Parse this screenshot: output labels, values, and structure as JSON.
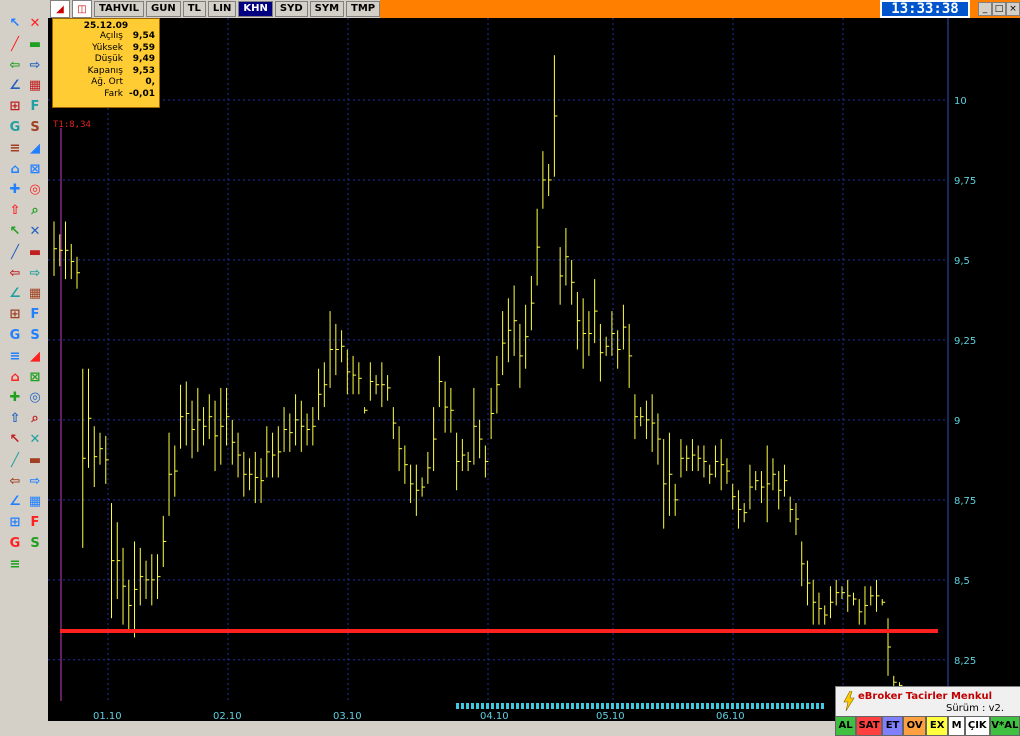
{
  "toolbar": {
    "tabs": [
      "TAHVIL",
      "GUN",
      "TL",
      "LIN",
      "KHN",
      "SYD",
      "SYM",
      "TMP"
    ],
    "active_tab": "KHN",
    "clock": "13:33:38",
    "window_buttons": [
      "_",
      "□",
      "×"
    ]
  },
  "infobox": {
    "date": "25.12.09",
    "rows": [
      {
        "label": "Açılış",
        "value": "9,54"
      },
      {
        "label": "Yüksek",
        "value": "9,59"
      },
      {
        "label": "Düşük",
        "value": "9,49"
      },
      {
        "label": "Kapanış",
        "value": "9,53"
      },
      {
        "label": "Ağ. Ort",
        "value": "0,"
      },
      {
        "label": "Fark",
        "value": "-0,01"
      }
    ]
  },
  "trendline_label": "T1:8,34",
  "colors": {
    "bars": "#ffff40",
    "trendline": "#ff2020",
    "grid": "#2030a0",
    "axis_text": "#5fd0e0",
    "titlebar": "#ff8000"
  },
  "chart_data": {
    "type": "ohlc",
    "y_ticks": [
      "10",
      "9,75",
      "9,5",
      "9,25",
      "9",
      "8,75",
      "8,5",
      "8,25"
    ],
    "x_ticks": [
      "01.10",
      "02.10",
      "03.10",
      "04.10",
      "05.10",
      "06.10"
    ],
    "ylim": [
      8.14,
      10.25
    ],
    "trendline_value": 8.34,
    "series": [
      {
        "h": 9.62,
        "l": 9.45
      },
      {
        "h": 9.58,
        "l": 9.48
      },
      {
        "h": 9.62,
        "l": 9.44
      },
      {
        "h": 9.55,
        "l": 9.44
      },
      {
        "h": 9.51,
        "l": 9.41
      },
      {
        "h": 9.16,
        "l": 8.6
      },
      {
        "h": 9.16,
        "l": 8.85
      },
      {
        "h": 8.98,
        "l": 8.79
      },
      {
        "h": 8.96,
        "l": 8.86
      },
      {
        "h": 8.95,
        "l": 8.8
      },
      {
        "h": 8.74,
        "l": 8.38
      },
      {
        "h": 8.68,
        "l": 8.44
      },
      {
        "h": 8.6,
        "l": 8.36
      },
      {
        "h": 8.5,
        "l": 8.34
      },
      {
        "h": 8.62,
        "l": 8.32
      },
      {
        "h": 8.6,
        "l": 8.42
      },
      {
        "h": 8.56,
        "l": 8.44
      },
      {
        "h": 8.58,
        "l": 8.42
      },
      {
        "h": 8.58,
        "l": 8.44
      },
      {
        "h": 8.7,
        "l": 8.54
      },
      {
        "h": 8.96,
        "l": 8.7
      },
      {
        "h": 8.92,
        "l": 8.76
      },
      {
        "h": 9.11,
        "l": 8.91
      },
      {
        "h": 9.12,
        "l": 8.92
      },
      {
        "h": 9.06,
        "l": 8.88
      },
      {
        "h": 9.1,
        "l": 8.9
      },
      {
        "h": 9.04,
        "l": 8.92
      },
      {
        "h": 9.08,
        "l": 8.94
      },
      {
        "h": 9.06,
        "l": 8.84
      },
      {
        "h": 9.1,
        "l": 8.86
      },
      {
        "h": 9.1,
        "l": 8.92
      },
      {
        "h": 9.0,
        "l": 8.86
      },
      {
        "h": 8.96,
        "l": 8.82
      },
      {
        "h": 8.9,
        "l": 8.76
      },
      {
        "h": 8.88,
        "l": 8.78
      },
      {
        "h": 8.9,
        "l": 8.74
      },
      {
        "h": 8.88,
        "l": 8.74
      },
      {
        "h": 8.98,
        "l": 8.82
      },
      {
        "h": 8.96,
        "l": 8.82
      },
      {
        "h": 8.98,
        "l": 8.82
      },
      {
        "h": 9.04,
        "l": 8.9
      },
      {
        "h": 9.02,
        "l": 8.9
      },
      {
        "h": 9.08,
        "l": 8.92
      },
      {
        "h": 9.06,
        "l": 8.9
      },
      {
        "h": 9.02,
        "l": 8.92
      },
      {
        "h": 9.04,
        "l": 8.92
      },
      {
        "h": 9.16,
        "l": 9.0
      },
      {
        "h": 9.18,
        "l": 9.04
      },
      {
        "h": 9.34,
        "l": 9.1
      },
      {
        "h": 9.3,
        "l": 9.14
      },
      {
        "h": 9.28,
        "l": 9.18
      },
      {
        "h": 9.22,
        "l": 9.08
      },
      {
        "h": 9.2,
        "l": 9.08
      },
      {
        "h": 9.18,
        "l": 9.08
      },
      {
        "h": 9.04,
        "l": 9.02
      },
      {
        "h": 9.18,
        "l": 9.06
      },
      {
        "h": 9.14,
        "l": 9.08
      },
      {
        "h": 9.18,
        "l": 9.04
      },
      {
        "h": 9.14,
        "l": 9.06
      },
      {
        "h": 9.04,
        "l": 8.94
      },
      {
        "h": 8.98,
        "l": 8.84
      },
      {
        "h": 8.92,
        "l": 8.8
      },
      {
        "h": 8.86,
        "l": 8.74
      },
      {
        "h": 8.86,
        "l": 8.7
      },
      {
        "h": 8.82,
        "l": 8.76
      },
      {
        "h": 8.9,
        "l": 8.8
      },
      {
        "h": 9.04,
        "l": 8.84
      },
      {
        "h": 9.2,
        "l": 9.04
      },
      {
        "h": 9.12,
        "l": 8.96
      },
      {
        "h": 9.1,
        "l": 8.96
      },
      {
        "h": 8.96,
        "l": 8.78
      },
      {
        "h": 8.94,
        "l": 8.84
      },
      {
        "h": 8.9,
        "l": 8.84
      },
      {
        "h": 9.1,
        "l": 8.86
      },
      {
        "h": 9.0,
        "l": 8.88
      },
      {
        "h": 8.92,
        "l": 8.82
      },
      {
        "h": 9.1,
        "l": 8.94
      },
      {
        "h": 9.2,
        "l": 9.02
      },
      {
        "h": 9.34,
        "l": 9.14
      },
      {
        "h": 9.38,
        "l": 9.18
      },
      {
        "h": 9.42,
        "l": 9.2
      },
      {
        "h": 9.3,
        "l": 9.1
      },
      {
        "h": 9.36,
        "l": 9.16
      },
      {
        "h": 9.45,
        "l": 9.28
      },
      {
        "h": 9.66,
        "l": 9.42
      },
      {
        "h": 9.84,
        "l": 9.66
      },
      {
        "h": 9.8,
        "l": 9.7
      },
      {
        "h": 10.14,
        "l": 9.76
      },
      {
        "h": 9.54,
        "l": 9.36
      },
      {
        "h": 9.6,
        "l": 9.42
      },
      {
        "h": 9.5,
        "l": 9.36
      },
      {
        "h": 9.4,
        "l": 9.22
      },
      {
        "h": 9.38,
        "l": 9.16
      },
      {
        "h": 9.34,
        "l": 9.2
      },
      {
        "h": 9.44,
        "l": 9.24
      },
      {
        "h": 9.3,
        "l": 9.12
      },
      {
        "h": 9.26,
        "l": 9.2
      },
      {
        "h": 9.34,
        "l": 9.2
      },
      {
        "h": 9.28,
        "l": 9.16
      },
      {
        "h": 9.36,
        "l": 9.22
      },
      {
        "h": 9.3,
        "l": 9.1
      },
      {
        "h": 9.08,
        "l": 8.94
      },
      {
        "h": 9.04,
        "l": 8.98
      },
      {
        "h": 9.06,
        "l": 8.94
      },
      {
        "h": 9.08,
        "l": 8.9
      },
      {
        "h": 9.02,
        "l": 8.86
      },
      {
        "h": 8.94,
        "l": 8.66
      },
      {
        "h": 8.96,
        "l": 8.7
      },
      {
        "h": 8.8,
        "l": 8.7
      },
      {
        "h": 8.94,
        "l": 8.82
      },
      {
        "h": 8.92,
        "l": 8.84
      },
      {
        "h": 8.94,
        "l": 8.84
      },
      {
        "h": 8.92,
        "l": 8.84
      },
      {
        "h": 8.92,
        "l": 8.82
      },
      {
        "h": 8.86,
        "l": 8.8
      },
      {
        "h": 8.92,
        "l": 8.82
      },
      {
        "h": 8.94,
        "l": 8.78
      },
      {
        "h": 8.88,
        "l": 8.8
      },
      {
        "h": 8.8,
        "l": 8.72
      },
      {
        "h": 8.78,
        "l": 8.66
      },
      {
        "h": 8.74,
        "l": 8.68
      },
      {
        "h": 8.86,
        "l": 8.72
      },
      {
        "h": 8.84,
        "l": 8.78
      },
      {
        "h": 8.84,
        "l": 8.74
      },
      {
        "h": 8.92,
        "l": 8.68
      },
      {
        "h": 8.88,
        "l": 8.78
      },
      {
        "h": 8.84,
        "l": 8.72
      },
      {
        "h": 8.86,
        "l": 8.76
      },
      {
        "h": 8.76,
        "l": 8.68
      },
      {
        "h": 8.74,
        "l": 8.64
      },
      {
        "h": 8.62,
        "l": 8.48
      },
      {
        "h": 8.56,
        "l": 8.42
      },
      {
        "h": 8.5,
        "l": 8.36
      },
      {
        "h": 8.46,
        "l": 8.36
      },
      {
        "h": 8.42,
        "l": 8.36
      },
      {
        "h": 8.48,
        "l": 8.38
      },
      {
        "h": 8.5,
        "l": 8.42
      },
      {
        "h": 8.48,
        "l": 8.44
      },
      {
        "h": 8.5,
        "l": 8.4
      },
      {
        "h": 8.46,
        "l": 8.42
      },
      {
        "h": 8.44,
        "l": 8.36
      },
      {
        "h": 8.48,
        "l": 8.36
      },
      {
        "h": 8.48,
        "l": 8.42
      },
      {
        "h": 8.5,
        "l": 8.4
      },
      {
        "h": 8.44,
        "l": 8.42
      },
      {
        "h": 8.38,
        "l": 8.2
      },
      {
        "h": 8.2,
        "l": 8.16
      },
      {
        "h": 8.18,
        "l": 8.16
      }
    ]
  },
  "brand": {
    "name": "eBroker Tacirler Menkul",
    "version": "Sürüm : v2."
  },
  "order_buttons": [
    {
      "label": "AL",
      "color": "#40c040"
    },
    {
      "label": "SAT",
      "color": "#ff4040"
    },
    {
      "label": "ET",
      "color": "#8080ff"
    },
    {
      "label": "OV",
      "color": "#ffa040"
    },
    {
      "label": "EX",
      "color": "#ffff40"
    },
    {
      "label": "M",
      "color": "#ffffff"
    },
    {
      "label": "ÇIK",
      "color": "#ffffff"
    },
    {
      "label": "V*AL",
      "color": "#40c040"
    }
  ],
  "tools": [
    "pointer-tool",
    "cross-tool",
    "line-tool",
    "eraser-tool",
    "arrow-tool",
    "gann-tool",
    "fibonacci-tool",
    "channel-tool",
    "text-tool",
    "zoom-tool"
  ]
}
